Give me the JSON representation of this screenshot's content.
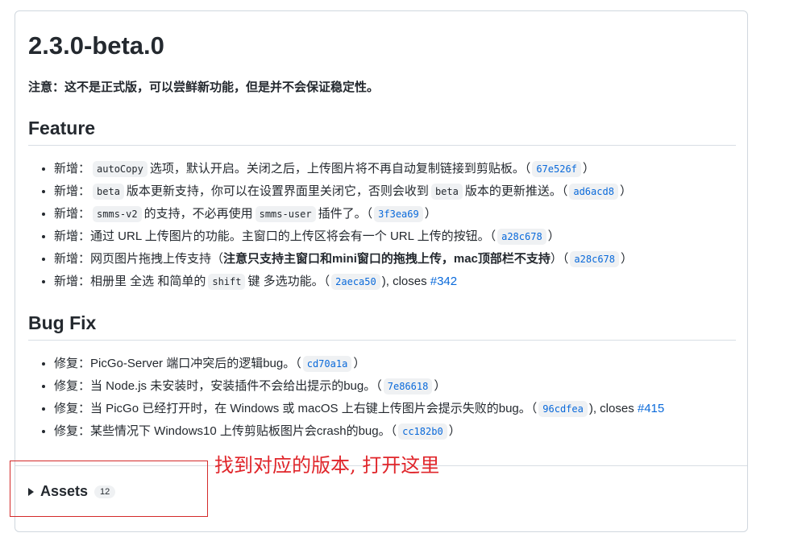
{
  "release": {
    "title": "2.3.0-beta.0",
    "notice": "注意：这不是正式版，可以尝鲜新功能，但是并不会保证稳定性。"
  },
  "feature": {
    "heading": "Feature",
    "items": [
      {
        "prefix": "新增：",
        "code": "autoCopy",
        "text": "选项，默认开启。关闭之后，上传图片将不再自动复制链接到剪贴板。（",
        "sha": "67e526f",
        "suffix": "）"
      },
      {
        "prefix": "新增：",
        "code": "beta",
        "text": "版本更新支持，你可以在设置界面里关闭它，否则会收到",
        "code2": "beta",
        "text2": "版本的更新推送。（",
        "sha": "ad6acd8",
        "suffix": "）"
      },
      {
        "prefix": "新增：",
        "code": "smms-v2",
        "text": "的支持，不必再使用",
        "code2": "smms-user",
        "text2": "插件了。（",
        "sha": "3f3ea69",
        "suffix": "）"
      },
      {
        "prefix": "新增：",
        "text": "通过 URL 上传图片的功能。主窗口的上传区将会有一个 URL 上传的按钮。（",
        "sha": "a28c678",
        "suffix": "）"
      },
      {
        "prefix": "新增：",
        "text": "网页图片拖拽上传支持（",
        "bold": "注意只支持主窗口和mini窗口的拖拽上传，mac顶部栏不支持",
        "text2": "）（",
        "sha": "a28c678",
        "suffix": "）"
      },
      {
        "prefix": "新增：",
        "text": "相册里 全选 和简单的",
        "code": "shift",
        "text2": "键 多选功能。（",
        "sha": "2aeca50",
        "suffix": "), closes ",
        "issue": "#342"
      }
    ]
  },
  "bugfix": {
    "heading": "Bug Fix",
    "items": [
      {
        "prefix": "修复：",
        "text": "PicGo-Server 端口冲突后的逻辑bug。（",
        "sha": "cd70a1a",
        "suffix": "）"
      },
      {
        "prefix": "修复：",
        "text": "当 Node.js 未安装时，安装插件不会给出提示的bug。（",
        "sha": "7e86618",
        "suffix": "）"
      },
      {
        "prefix": "修复：",
        "text": "当 PicGo 已经打开时，在 Windows 或 macOS 上右键上传图片会提示失败的bug。（",
        "sha": "96cdfea",
        "suffix": "), closes ",
        "issue": "#415"
      },
      {
        "prefix": "修复：",
        "text": "某些情况下 Windows10 上传剪贴板图片会crash的bug。（",
        "sha": "cc182b0",
        "suffix": "）"
      }
    ]
  },
  "assets": {
    "label": "Assets",
    "count": "12"
  },
  "annotation": {
    "text": "找到对应的版本, 打开这里",
    "color": "#e0262b"
  }
}
